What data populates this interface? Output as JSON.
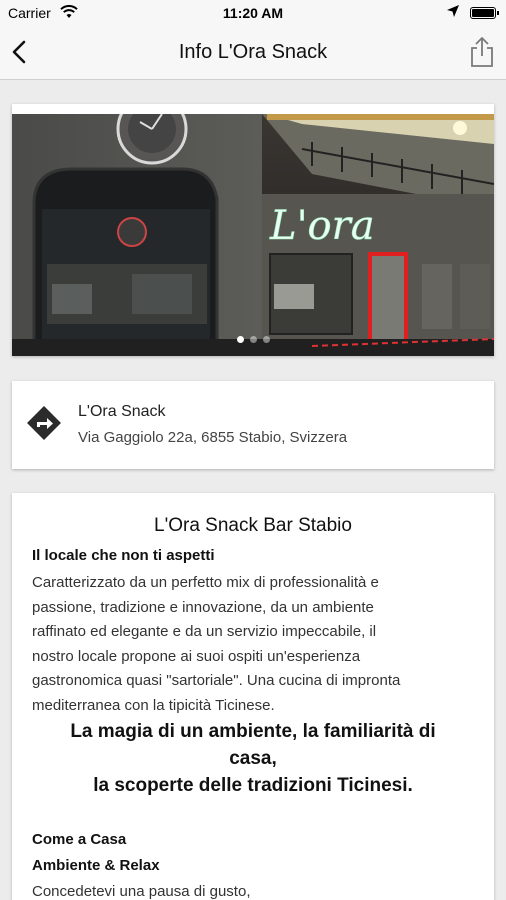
{
  "status_bar": {
    "carrier": "Carrier",
    "time": "11:20 AM",
    "icons": [
      "wifi-icon",
      "location-arrow-icon",
      "battery-icon"
    ]
  },
  "nav": {
    "title": "Info L'Ora Snack",
    "icons": [
      "back-chevron-icon",
      "share-icon"
    ]
  },
  "gallery": {
    "image": "Facade of L'Ora snack bar at night with neon sign and clock",
    "sign_text": "L'ora",
    "dots": 3,
    "active_dot": 0
  },
  "location": {
    "name": "L'Ora Snack",
    "address": "Via Gaggiolo 22a, 6855 Stabio, Svizzera",
    "icon": "directions-icon"
  },
  "description": {
    "title": "L'Ora Snack Bar Stabio",
    "subtitle": "Il locale che non ti aspetti",
    "paragraph_lines": [
      "Caratterizzato da un perfetto mix di professionalità e",
      "passione, tradizione e innovazione, da un ambiente",
      "raffinato ed elegante e da un servizio impeccabile, il",
      "nostro locale  propone ai suoi ospiti un'esperienza",
      "gastronomica quasi \"sartoriale\". Una cucina di impronta",
      "mediterranea con la tipicità Ticinese."
    ],
    "highlight_lines": [
      "La magia di un ambiente, la familiarità di",
      "casa,",
      "la scoperte delle tradizioni Ticinesi."
    ],
    "section_home": "Come a Casa",
    "section_relax": "Ambiente & Relax",
    "tail_text": "Concedetevi una pausa di gusto,"
  },
  "colors": {
    "bar_bg": "#f7f7f7",
    "page_bg": "#ececec",
    "card_bg": "#ffffff",
    "text": "#111111"
  }
}
